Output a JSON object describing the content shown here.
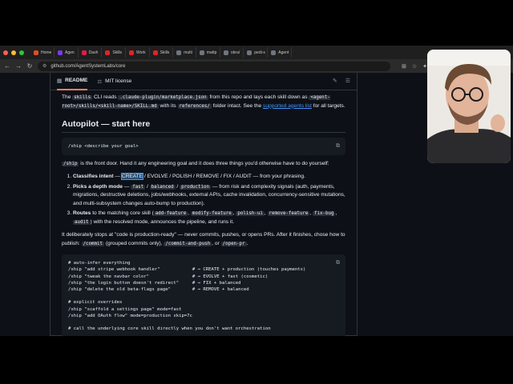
{
  "tabs": [
    {
      "label": "Home",
      "color": "#e34c26"
    },
    {
      "label": "Agen",
      "color": "#7c3aed"
    },
    {
      "label": "Dash",
      "color": "#e11d48"
    },
    {
      "label": "Skills",
      "color": "#dc2626"
    },
    {
      "label": "Work",
      "color": "#dc2626"
    },
    {
      "label": "Skills",
      "color": "#dc2626"
    },
    {
      "label": "multi",
      "color": "#6e7681"
    },
    {
      "label": "mattp",
      "color": "#6e7681"
    },
    {
      "label": "obra/",
      "color": "#6e7681"
    },
    {
      "label": "pedi-s",
      "color": "#6e7681"
    },
    {
      "label": "Agent",
      "color": "#6e7681"
    }
  ],
  "url": "github.com/AgentSystemLabs/core",
  "readme_tabs": {
    "readme": "README",
    "license": "MIT license"
  },
  "intro": {
    "t1": "The ",
    "c1": "skills",
    "t2": " CLI reads ",
    "c2": ".claude-plugin/marketplace.json",
    "t3": " from this repo and lays each skill down as ",
    "c3": "<agent-root>/skills/<skill-name>/SKILL.md",
    "t4": " with its ",
    "c4": "references/",
    "t5": " folder intact. See the ",
    "link": "supported agents list",
    "t6": " for all targets."
  },
  "heading": "Autopilot — start here",
  "code1": "/ship <describe your goal>",
  "front": {
    "c": "/ship",
    "t": " is the front door. Hand it any engineering goal and it does three things you'd otherwise have to do yourself:"
  },
  "list": {
    "l1_b": "Classifies intent",
    "l1_t1": " — ",
    "l1_sel": "CREATE",
    "l1_t2": " / EVOLVE / POLISH / REMOVE / FIX / AUDIT — from your phrasing.",
    "l2_b": "Picks a depth mode",
    "l2_t1": " — ",
    "l2_c1": "fast",
    "l2_t2": " / ",
    "l2_c2": "balanced",
    "l2_t3": " / ",
    "l2_c3": "production",
    "l2_t4": " — from risk and complexity signals (auth, payments, migrations, destructive deletions, jobs/webhooks, external APIs, cache invalidation, concurrency-sensitive mutations, and multi-subsystem changes auto-bump to production).",
    "l3_b": "Routes",
    "l3_t1": " to the matching core skill (",
    "l3_c1": "add-feature",
    "l3_c2": "modify-feature",
    "l3_c3": "polish-ui",
    "l3_c4": "remove-feature",
    "l3_c5": "fix-bug",
    "l3_c6": "audit",
    "l3_sep": ", ",
    "l3_t2": ") with the resolved mode, announces the pipeline, and runs it."
  },
  "stops": {
    "t1": "It deliberately stops at \"code is production-ready\" — never commits, pushes, or opens PRs. After it finishes, chose how to publish: ",
    "c1": "/commit",
    "t2": " (grouped commits only), ",
    "c2": "/commit-and-push",
    "t3": ", or ",
    "c3": "/open-pr",
    "t4": "."
  },
  "code2": "# auto-infer everything\n/ship \"add stripe webhook handler\"            # → CREATE + production (touches payments)\n/ship \"tweak the navbar color\"                # → EVOLVE + fast (cosmetic)\n/ship \"the login button doesn't redirect\"     # → FIX + balanced\n/ship \"delete the old beta-flags page\"        # → REMOVE + balanced\n\n# explicit overrides\n/ship \"scaffold a settings page\" mode=fast\n/ship \"add OAuth flow\" mode=production skip=7c\n\n# call the underlying core skill directly when you don't want orchestration"
}
